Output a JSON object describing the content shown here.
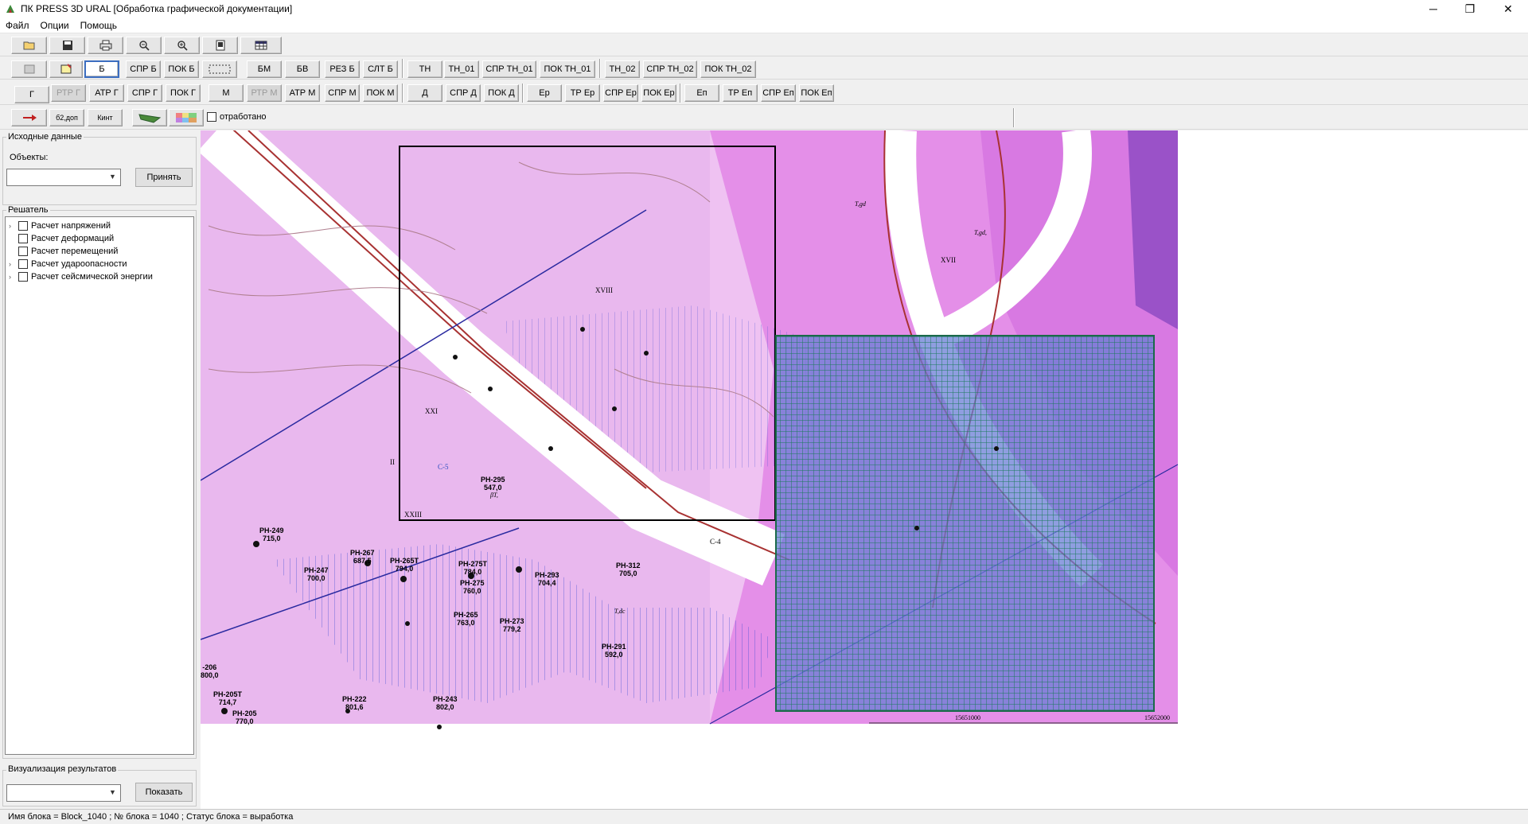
{
  "window": {
    "title": "ПК PRESS 3D URAL [Обработка  графической  документации]",
    "controls": [
      "─",
      "❐",
      "✕"
    ]
  },
  "menu": [
    "Файл",
    "Опции",
    "Помощь"
  ],
  "toolbar_row2": {
    "b_label": "Б",
    "spr_b": "СПР Б",
    "pok_b": "ПОК Б",
    "bm": "БМ",
    "bv": "БВ",
    "rez_b": "РЕЗ Б",
    "slt_b": "СЛТ Б",
    "tn": "ТН",
    "tn01": "ТН_01",
    "spr_tn01": "СПР ТН_01",
    "pok_tn01": "ПОК ТН_01",
    "tn02": "ТН_02",
    "spr_tn02": "СПР ТН_02",
    "pok_tn02": "ПОК ТН_02"
  },
  "toolbar_row3": {
    "g": "Г",
    "rtr_g": "РТР Г",
    "atr_g": "АТР Г",
    "spr_g": "СПР Г",
    "pok_g": "ПОК Г",
    "m": "М",
    "rtr_m": "РТР М",
    "atr_m": "АТР М",
    "spr_m": "СПР М",
    "pok_m": "ПОК М",
    "d": "Д",
    "spr_d": "СПР Д",
    "pok_d": "ПОК Д",
    "ep": "Ер",
    "tr_ep": "ТР Ер",
    "spr_ep": "СПР Ер",
    "pok_ep": "ПОК Ер",
    "en": "Еп",
    "tr_en": "ТР Еп",
    "spr_en": "СПР Еп",
    "pok_en": "ПОК Еп"
  },
  "toolbar_row4": {
    "icon2_label": "б2,доп",
    "icon3_label": "Кинт",
    "checkbox_label": "отработано"
  },
  "left_panel": {
    "source_group": "Исходные данные",
    "objects_label": "Объекты:",
    "objects_value": "",
    "accept_button": "Принять",
    "solver_group": "Решатель",
    "tree_items": [
      "Расчет напряжений",
      "Расчет деформаций",
      "Расчет перемещений",
      "Расчет удароопасности",
      "Расчет сейсмической энергии"
    ],
    "viz_group": "Визуализация результатов",
    "viz_value": "",
    "show_button": "Показать"
  },
  "map": {
    "labels": [
      "РН-295",
      "547,0",
      "РН-249",
      "715,0",
      "РН-267",
      "687,5",
      "РН-247",
      "700,0",
      "РН-265Т",
      "794,0",
      "РН-275Т",
      "784,0",
      "РН-275",
      "760,0",
      "РН-293",
      "704,4",
      "РН-312",
      "705,0",
      "РН-265",
      "763,0",
      "РН-273",
      "779,2",
      "РН-291",
      "592,0",
      "РН-222",
      "801,6",
      "РН-243",
      "802,0",
      "РН-205Т",
      "714,7",
      "РН-205",
      "770,0",
      "-206",
      "800,0",
      "XXI",
      "XVIII",
      "XVII",
      "XXIII",
      "II",
      "С-4",
      "С-5",
      "15651000",
      "15652000",
      "T,gd",
      "T,dc",
      "βT,",
      "T,gd,"
    ],
    "colors": {
      "pink": "#f0c0f0",
      "magenta": "#e080e8",
      "purple": "#9050c8",
      "grid": "#1a7a5a",
      "road": "#a03030"
    }
  },
  "status": "Имя блока = Block_1040 ; № блока = 1040 ; Статус блока = выработка"
}
